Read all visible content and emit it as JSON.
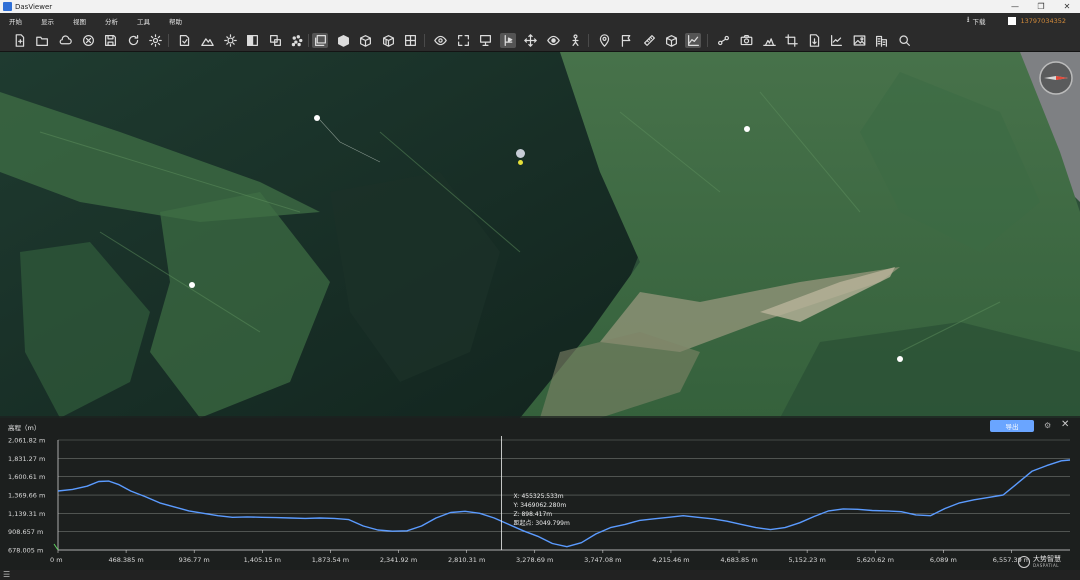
{
  "window": {
    "title": "DasViewer",
    "minimize": "—",
    "restore": "❐",
    "close": "✕"
  },
  "menu": {
    "items": [
      "开始",
      "显示",
      "视图",
      "分析",
      "工具",
      "帮助"
    ],
    "download_label": "下载",
    "user_phone": "13797034352"
  },
  "toolbar": {
    "icons": [
      "new-project-icon",
      "open-file-icon",
      "open-cloud-icon",
      "close-model-icon",
      "save-icon",
      "refresh-icon",
      "settings-icon",
      "import-icon",
      "terrain-icon",
      "lighting-icon",
      "shading-icon",
      "model-swap-icon",
      "point-cloud-icon",
      "layers-icon",
      "cube-solid-icon",
      "cube-wire-icon",
      "cube-textured-icon",
      "grid-tiles-icon",
      "eye-icon",
      "fullscreen-icon",
      "presentation-icon",
      "pick-point-icon",
      "move-icon",
      "orbit-view-icon",
      "pedestrian-icon",
      "location-pin-icon",
      "flag-icon",
      "ruler-icon",
      "volume-icon",
      "elevation-profile-icon",
      "measure-area-icon",
      "camera-icon",
      "screenshot-area-icon",
      "crop-icon",
      "export-file-icon",
      "chart-trend-icon",
      "image-icon",
      "building-icon",
      "search-icon"
    ]
  },
  "viewport": {
    "compass": "compass-icon"
  },
  "profile": {
    "title": "高程（m）",
    "export_label": "导出",
    "close": "✕",
    "settings": "⚙",
    "cursor_readout": {
      "x": "X: 455325.533m",
      "y": "Y: 3469062.280m",
      "z": "Z: 898.417m",
      "distance": "距起点: 3049.799m"
    }
  },
  "chart_data": {
    "type": "line",
    "title": "",
    "xlabel": "",
    "ylabel": "高程（m）",
    "x_tick_labels": [
      "0 m",
      "468.385 m",
      "936.77 m",
      "1,405.15 m",
      "1,873.54 m",
      "2,341.92 m",
      "2,810.31 m",
      "3,278.69 m",
      "3,747.08 m",
      "4,215.46 m",
      "4,683.85 m",
      "5,152.23 m",
      "5,620.62 m",
      "6,089 m",
      "6,557.39 m"
    ],
    "x_ticks": [
      0,
      468.385,
      936.77,
      1405.15,
      1873.54,
      2341.92,
      2810.31,
      3278.69,
      3747.08,
      4215.46,
      4683.85,
      5152.23,
      5620.62,
      6089,
      6557.39
    ],
    "y_tick_labels": [
      "2,061.82 m",
      "1,831.27 m",
      "1,600.61 m",
      "1,369.66 m",
      "1,139.31 m",
      "908.657 m",
      "678.005 m"
    ],
    "y_ticks": [
      2061.82,
      1831.27,
      1600.61,
      1369.66,
      1139.31,
      908.657,
      678.005
    ],
    "xlim": [
      0,
      6960
    ],
    "ylim": [
      678.005,
      2061.82
    ],
    "grid": true,
    "cursor_x": 3049.799,
    "color": "#5b9bff",
    "series": [
      {
        "x": [
          0,
          100,
          200,
          280,
          350,
          420,
          500,
          600,
          700,
          800,
          900,
          1000,
          1100,
          1200,
          1300,
          1400,
          1500,
          1600,
          1700,
          1800,
          1900,
          2000,
          2100,
          2200,
          2300,
          2400,
          2500,
          2600,
          2700,
          2800,
          2900,
          3000,
          3100,
          3200,
          3300,
          3400,
          3500,
          3600,
          3700,
          3800,
          3900,
          4000,
          4100,
          4200,
          4300,
          4400,
          4500,
          4600,
          4700,
          4800,
          4900,
          5000,
          5100,
          5200,
          5300,
          5400,
          5500,
          5600,
          5700,
          5800,
          5900,
          6000,
          6100,
          6200,
          6300,
          6400,
          6500,
          6600,
          6700,
          6800,
          6900,
          6960
        ],
        "y": [
          1420,
          1440,
          1480,
          1540,
          1545,
          1500,
          1420,
          1350,
          1270,
          1220,
          1170,
          1140,
          1110,
          1090,
          1095,
          1090,
          1085,
          1080,
          1075,
          1080,
          1075,
          1060,
          980,
          930,
          915,
          920,
          980,
          1080,
          1150,
          1165,
          1140,
          1080,
          1000,
          920,
          850,
          760,
          720,
          770,
          880,
          960,
          1000,
          1050,
          1070,
          1090,
          1110,
          1090,
          1070,
          1040,
          1000,
          960,
          935,
          960,
          1020,
          1100,
          1170,
          1195,
          1190,
          1175,
          1170,
          1160,
          1120,
          1110,
          1200,
          1270,
          1310,
          1340,
          1370,
          1520,
          1670,
          1740,
          1800,
          1810
        ]
      }
    ]
  }
}
